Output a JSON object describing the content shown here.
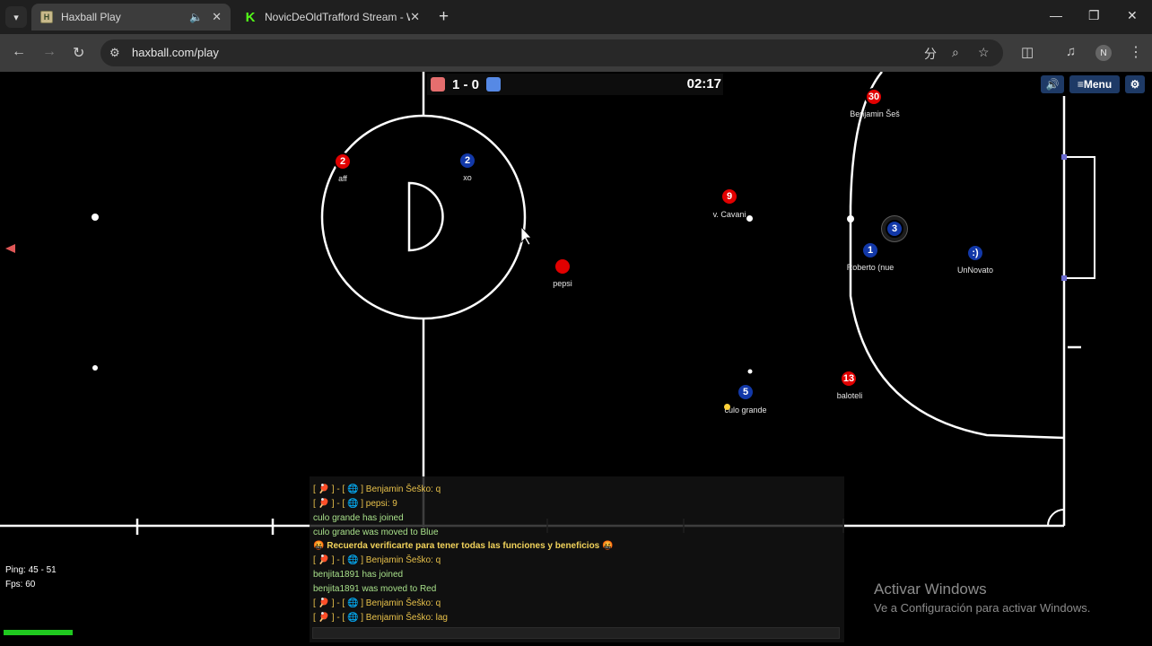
{
  "browser": {
    "tabs": [
      {
        "title": "Haxball Play",
        "icon": "haxball-favicon",
        "active": true
      },
      {
        "title": "NovicDeOldTrafford Stream - W",
        "icon": "kick-favicon",
        "active": false
      }
    ],
    "url": "haxball.com/play",
    "profile_initial": "N"
  },
  "hud": {
    "score": "1 - 0",
    "timer": "02:17",
    "menu_label": "≡Menu"
  },
  "players": [
    {
      "number": "2",
      "name": "aff",
      "team": "red"
    },
    {
      "number": "2",
      "name": "xo",
      "team": "blue"
    },
    {
      "number": "9",
      "name": "v. Cavani",
      "team": "red"
    },
    {
      "number": "",
      "name": "pepsi",
      "team": "red"
    },
    {
      "number": "30",
      "name": "Benjamin Šeš",
      "team": "red"
    },
    {
      "number": "3",
      "name": "",
      "team": "blue"
    },
    {
      "number": "1",
      "name": "Roberto (nue",
      "team": "blue"
    },
    {
      "number": ":)",
      "name": "UnNovato",
      "team": "blue"
    },
    {
      "number": "5",
      "name": "culo grande",
      "team": "blue"
    },
    {
      "number": "13",
      "name": "baloteli",
      "team": "red"
    }
  ],
  "chat": {
    "lines": [
      {
        "text": "[ 🏓 ] - [ 🌐 ] Benjamin Šeško: q",
        "kind": "player"
      },
      {
        "text": "[ 🏓 ] - [ 🌐 ] pepsi: 9",
        "kind": "player"
      },
      {
        "text": "culo grande has joined",
        "kind": "system"
      },
      {
        "text": "culo grande was moved to Blue",
        "kind": "system"
      },
      {
        "text": "🤬 Recuerda verificarte para tener todas las funciones y beneficios 🤬",
        "kind": "announce"
      },
      {
        "text": "[ 🏓 ] - [ 🌐 ] Benjamin Šeško: q",
        "kind": "player"
      },
      {
        "text": "benjita1891 has joined",
        "kind": "system"
      },
      {
        "text": "benjita1891 was moved to Red",
        "kind": "system"
      },
      {
        "text": "[ 🏓 ] - [ 🌐 ] Benjamin Šeško: q",
        "kind": "player"
      },
      {
        "text": "[ 🏓 ] - [ 🌐 ] Benjamin Šeško: lag",
        "kind": "player"
      }
    ]
  },
  "stats": {
    "ping": "Ping: 45 - 51",
    "fps": "Fps: 60"
  },
  "watermark": {
    "title": "Activar Windows",
    "subtitle": "Ve a Configuración para activar Windows."
  },
  "colors": {
    "red_team": "#e10000",
    "blue_team": "#1238a8",
    "score_red": "#e56e6e",
    "score_blue": "#5689e5",
    "chat_system": "#a8e08a",
    "chat_player": "#e8c14a",
    "stamina": "#1fc81f"
  }
}
